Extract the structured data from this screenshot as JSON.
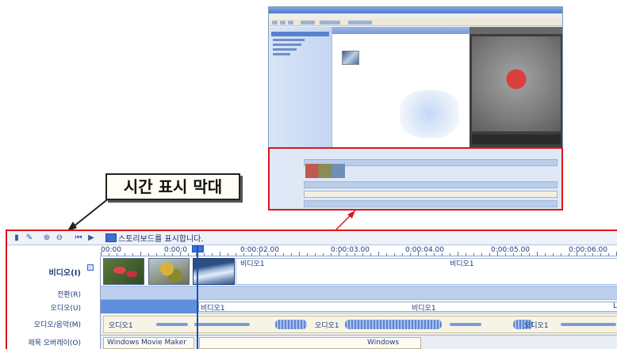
{
  "callout": {
    "text": "시간 표시 막대"
  },
  "toolbar": {
    "label": "스토리보드를 표시합니다."
  },
  "ruler": {
    "labels": [
      "00:00",
      "0:00:0",
      "0:00:02.00",
      "0:00:03.00",
      "0:00:04.00",
      "0:00:05.00",
      "0:00:06.00"
    ]
  },
  "tracks": {
    "video": "비디오(I)",
    "transition": "전환(R)",
    "audio": "오디오(U)",
    "music": "오디오/음악(M)",
    "title": "제목 오버레이(O)"
  },
  "clips": {
    "video_label_1": "비디오1",
    "video_label_2": "비디오1",
    "audio_label_1": "비디오1",
    "audio_label_2": "비디오1",
    "audio_label_3": "L",
    "music_label_1": "오디오1",
    "music_label_2": "오디오1",
    "music_label_3": "오디오1",
    "title_label_1": "Windows Movie Maker",
    "title_label_2": "Windows"
  },
  "colors": {
    "highlight": "#e0141b",
    "timeline_accent": "#3d6fd6",
    "track_blue": "#bcd0ed"
  },
  "icons": [
    "storyboard-icon",
    "properties-icon",
    "zoom-in-icon",
    "zoom-out-icon",
    "rewind-icon",
    "play-icon",
    "storyboard-toggle-icon"
  ]
}
